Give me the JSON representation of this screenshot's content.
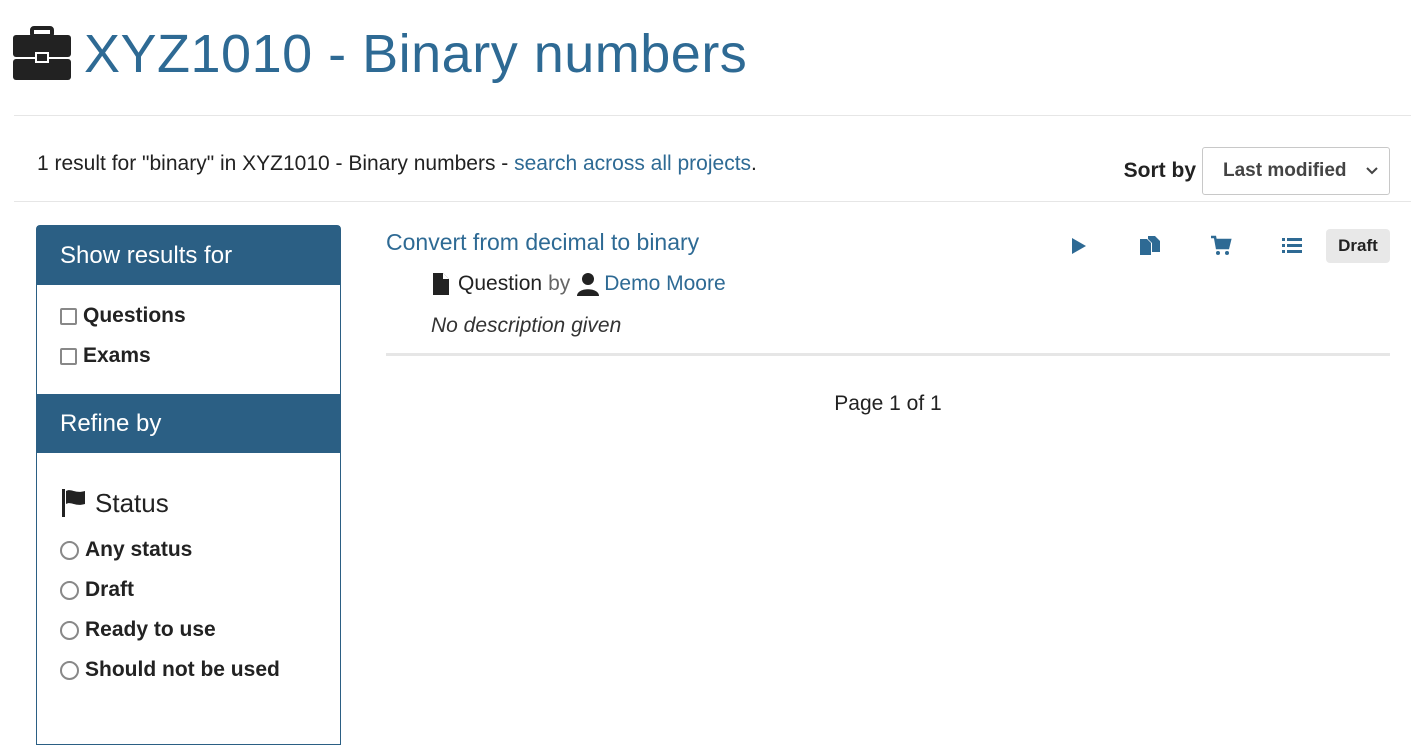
{
  "header": {
    "icon": "briefcase-icon",
    "title": "XYZ1010 - Binary numbers"
  },
  "summary": {
    "text": "1 result for \"binary\" in XYZ1010 - Binary numbers - ",
    "link": "search across all projects",
    "end": "."
  },
  "sort": {
    "label": "Sort by",
    "selected": "Last modified"
  },
  "sidebar": {
    "show_results_heading": "Show results for",
    "types": [
      {
        "label": "Questions",
        "checked": false
      },
      {
        "label": "Exams",
        "checked": false
      }
    ],
    "refine_heading": "Refine by",
    "status_heading": "Status",
    "status_options": [
      {
        "label": "Any status"
      },
      {
        "label": "Draft"
      },
      {
        "label": "Ready to use"
      },
      {
        "label": "Should not be used"
      }
    ]
  },
  "result": {
    "title": "Convert from decimal to binary",
    "type": "Question",
    "by": "by",
    "author": "Demo Moore",
    "description": "No description given",
    "status": "Draft",
    "actions": [
      "play-icon",
      "copy-icon",
      "cart-icon",
      "list-icon"
    ]
  },
  "pager": {
    "text": "Page 1 of 1"
  },
  "colors": {
    "accent": "#2e6a94",
    "panel": "#2b5f84"
  }
}
